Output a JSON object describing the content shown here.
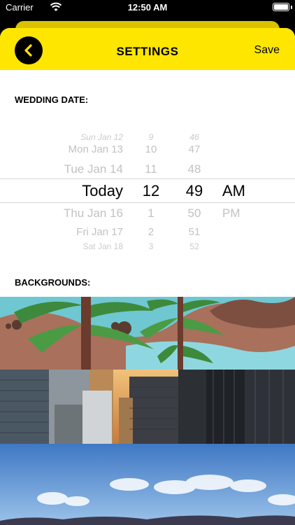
{
  "status_bar": {
    "carrier": "Carrier",
    "time": "12:50 AM"
  },
  "header": {
    "title": "SETTINGS",
    "save_label": "Save"
  },
  "wedding_date": {
    "label": "WEDDING DATE:",
    "rows": [
      {
        "date": "Sun Jan 12",
        "hour": "9",
        "minute": "46",
        "ampm": ""
      },
      {
        "date": "Mon Jan 13",
        "hour": "10",
        "minute": "47",
        "ampm": ""
      },
      {
        "date": "Tue Jan 14",
        "hour": "11",
        "minute": "48",
        "ampm": ""
      },
      {
        "date": "Today",
        "hour": "12",
        "minute": "49",
        "ampm": "AM"
      },
      {
        "date": "Thu Jan 16",
        "hour": "1",
        "minute": "50",
        "ampm": "PM"
      },
      {
        "date": "Fri Jan 17",
        "hour": "2",
        "minute": "51",
        "ampm": ""
      },
      {
        "date": "Sat Jan 18",
        "hour": "3",
        "minute": "52",
        "ampm": ""
      }
    ]
  },
  "backgrounds": {
    "label": "BACKGROUNDS:",
    "items": [
      "forest-mountain-illustration",
      "city-skyscrapers-photo",
      "sky-clouds-photo"
    ]
  },
  "colors": {
    "accent": "#ffe600",
    "text": "#000000",
    "picker_faded": "#c2c2c2"
  }
}
